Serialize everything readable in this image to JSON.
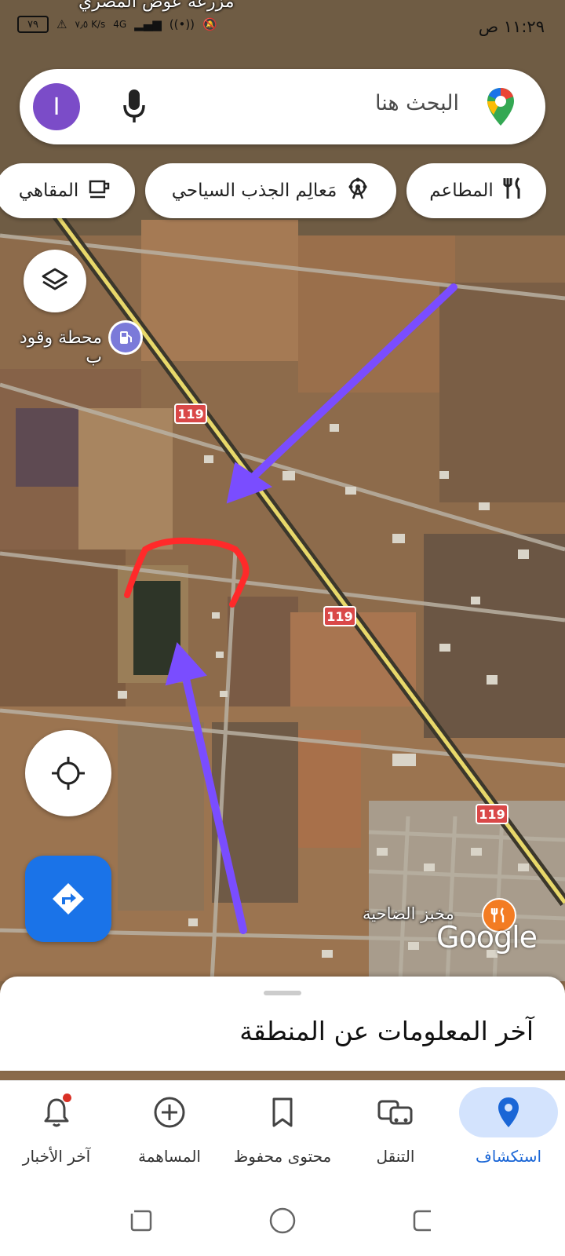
{
  "statusbar": {
    "time": "١١:٢٩ ص",
    "battery": "٧٩",
    "network": "4G",
    "speed": "٧٫٥ K/s",
    "top_place": "مزرعة عوض المصري"
  },
  "search": {
    "placeholder": "البحث هنا",
    "avatar_letter": "I"
  },
  "chips": [
    {
      "label": "المطاعم",
      "icon": "fork-knife-icon"
    },
    {
      "label": "مَعالِم الجذب السياحي",
      "icon": "ferris-wheel-icon"
    },
    {
      "label": "المقاهي",
      "icon": "coffee-cup-icon"
    }
  ],
  "map": {
    "gas_station_label": "محطة وقود ب",
    "road_number": "119",
    "town_label": "مخبز الضاحية",
    "watermark": "Google",
    "colors": {
      "annotation_arrow": "#7a4dff",
      "annotation_outline": "#ff2a2a",
      "road_shield": "#d94848",
      "highway": "#e8d86a"
    }
  },
  "sheet": {
    "title": "آخر المعلومات عن المنطقة"
  },
  "bottom_nav": [
    {
      "label": "استكشاف",
      "icon": "pin-icon",
      "active": true
    },
    {
      "label": "التنقل",
      "icon": "commute-icon",
      "active": false
    },
    {
      "label": "محتوى محفوظ",
      "icon": "bookmark-icon",
      "active": false
    },
    {
      "label": "المساهمة",
      "icon": "add-circle-icon",
      "active": false
    },
    {
      "label": "آخر الأخبار",
      "icon": "bell-icon",
      "active": false
    }
  ]
}
